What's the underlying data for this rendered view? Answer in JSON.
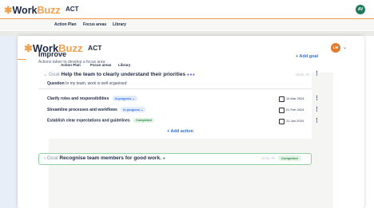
{
  "app": {
    "logo_prefix": "Work",
    "logo_suffix": "Buzz",
    "org": "ACT"
  },
  "outer": {
    "avatar": "AV",
    "tabs": [
      "Action Plan",
      "Focus areas",
      "Library"
    ]
  },
  "inner": {
    "avatar": "LM",
    "tabs": [
      "Action Plan",
      "Focus areas",
      "Library"
    ]
  },
  "section": {
    "title": "Improve",
    "subtitle": "Actions taken to develop a focus area",
    "add_goal": "+ Add goal"
  },
  "goal1": {
    "label": "Goal",
    "title": "Help the team to clearly understand their priorities",
    "level": "LEVEL: P2",
    "question_label": "Question",
    "question_text": "In my team, work is well organised"
  },
  "actions": [
    {
      "title": "Clarify roles and responsibilities",
      "status": "In progress ⌄",
      "date": "14 Mar 2024"
    },
    {
      "title": "Streamline processes and workflows",
      "status": "In progress ⌄",
      "date": "21 Feb 2024"
    },
    {
      "title": "Establish clear expectations and guidelines",
      "status": "Completed",
      "date": "21 Jan 2024"
    }
  ],
  "add_action": "+ Add action",
  "goal2": {
    "label": "Goal",
    "title": "Recognise team members for good work.",
    "level": "LEVEL: P3",
    "status": "Completed"
  },
  "colors": {
    "brand_orange": "#f3a04f",
    "navy": "#1f2a44",
    "link_blue": "#2e6fe0",
    "success_green": "#2f8a46"
  }
}
